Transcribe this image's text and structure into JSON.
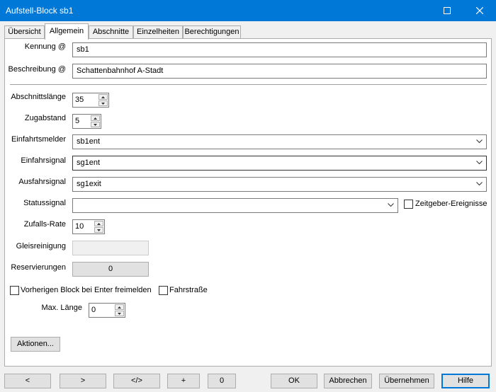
{
  "window": {
    "title": "Aufstell-Block sb1"
  },
  "tabs": [
    "Übersicht",
    "Allgemein",
    "Abschnitte",
    "Einzelheiten",
    "Berechtigungen"
  ],
  "fields": {
    "kennung": {
      "label": "Kennung @",
      "value": "sb1"
    },
    "beschreibung": {
      "label": "Beschreibung @",
      "value": "Schattenbahnhof A-Stadt"
    },
    "abschnittslaenge": {
      "label": "Abschnittslänge",
      "value": "35"
    },
    "zugabstand": {
      "label": "Zugabstand",
      "value": "5"
    },
    "einfahrtsmelder": {
      "label": "Einfahrtsmelder",
      "value": "sb1ent"
    },
    "einfahrsignal": {
      "label": "Einfahrsignal",
      "value": "sg1ent"
    },
    "ausfahrsignal": {
      "label": "Ausfahrsignal",
      "value": "sg1exit"
    },
    "statussignal": {
      "label": "Statussignal",
      "value": ""
    },
    "zeitgeber": {
      "label": "Zeitgeber-Ereignisse"
    },
    "zufallsrate": {
      "label": "Zufalls-Rate",
      "value": "10"
    },
    "gleisreinigung": {
      "label": "Gleisreinigung",
      "value": ""
    },
    "reservierungen": {
      "label": "Reservierungen",
      "value": "0"
    },
    "vorherigen": {
      "label": "Vorherigen Block bei Enter freimelden"
    },
    "fahrstrasse": {
      "label": "Fahrstraße"
    },
    "maxlaenge": {
      "label": "Max. Länge",
      "value": "0"
    }
  },
  "actions_label": "Aktionen...",
  "bottom": {
    "prev": "<",
    "next": ">",
    "code": "</>",
    "plus": "+",
    "zero": "0",
    "ok": "OK",
    "cancel": "Abbrechen",
    "apply": "Übernehmen",
    "help": "Hilfe"
  }
}
